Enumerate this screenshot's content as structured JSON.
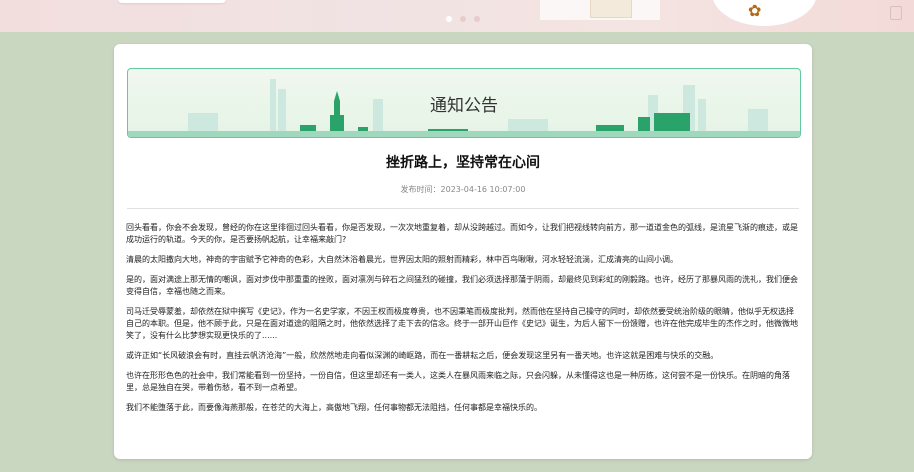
{
  "notice": {
    "banner_title": "通知公告",
    "article_title": "挫折路上，坚持常在心间",
    "meta_label": "发布时间：",
    "meta_date": "2023-04-16 10:07:00",
    "paragraphs": [
      "回头看看，你会不会发现，曾经的你在这里徘徊过回头看看，你是否发现，一次次地重复着，却从没跨越过。而如今，让我们把视线转向前方，那一道道金色的弧线，是流星飞渐的痕迹，或是成功运行的轨道。今天的你，是否要扬帆起航，让幸福来敲门?",
      "清晨的太阳撒向大地，神奇的宇宙赋予它神奇的色彩，大自然沐浴着晨光，世界因太阳的照射而精彩，林中百鸟啾啾，河水轻轻流淌，汇成清亮的山间小调。",
      "是的，面对满途上那无情的嘲讽，面对步伐中那重重的挫败，面对凛冽与碎石之间猛烈的碰撞，我们必须选择那蒲于阴雨，却最终见到彩虹的刚毅路。也许，经历了那暴风雨的洗礼，我们便会变得自信，幸福也随之而来。",
      "司马迁受辱蒙羞，却依然在狱中撰写《史记》，作为一名史学家，不因王权而极度尊贵，也不因秉笔而极度批判，然而他在坚持自己操守的同时，却依然要受统治阶级的眼睛，他似乎无权选择自己的本职。但是，他不顾于此，只是在面对道途的阻隔之时，他依然选择了走下去的信念。终于一部开山巨作《史记》诞生，为后人留下一份馈赠，也许在他完成毕生的杰作之时，他微微地笑了，没有什么比梦想实现更快乐的了......",
      "或许正如“长风破浪会有时，直挂云帆济沧海”一般，欣然然地走向看似深渊的崎岖路，而在一番耕耘之后，便会发现这里另有一番天地。也许这就是困难与快乐的交融。",
      "也许在形形色色的社会中，我们常能看到一份坚持，一份自信，但这里却还有一类人，这类人在暴风雨来临之际，只会闪躲，从未懂得这也是一种历练，这何尝不是一份快乐。在阴暗的角落里，总是独自在哭，带着伤愁，看不到一点希望。",
      "我们不能堕落于此，而要像海燕那般，在苍茫的大海上，高傲地飞翔，任何事物都无法阻挡，任何事都是幸福快乐的。"
    ]
  }
}
